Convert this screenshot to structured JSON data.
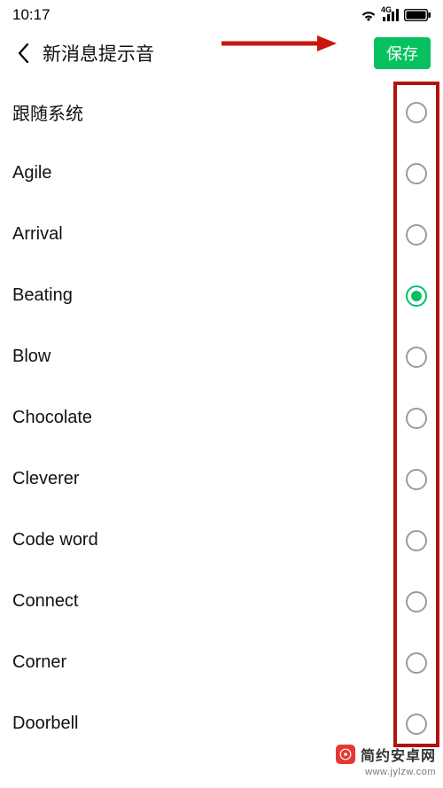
{
  "statusbar": {
    "time": "10:17",
    "network_icon": "4G"
  },
  "header": {
    "title": "新消息提示音",
    "save_label": "保存"
  },
  "sounds": {
    "selected_index": 3,
    "items": [
      {
        "label": "跟随系统"
      },
      {
        "label": "Agile"
      },
      {
        "label": "Arrival"
      },
      {
        "label": "Beating"
      },
      {
        "label": "Blow"
      },
      {
        "label": "Chocolate"
      },
      {
        "label": "Cleverer"
      },
      {
        "label": "Code word"
      },
      {
        "label": "Connect"
      },
      {
        "label": "Corner"
      },
      {
        "label": "Doorbell"
      }
    ]
  },
  "watermark": {
    "brand": "简约安卓网",
    "url": "www.jylzw.com"
  }
}
